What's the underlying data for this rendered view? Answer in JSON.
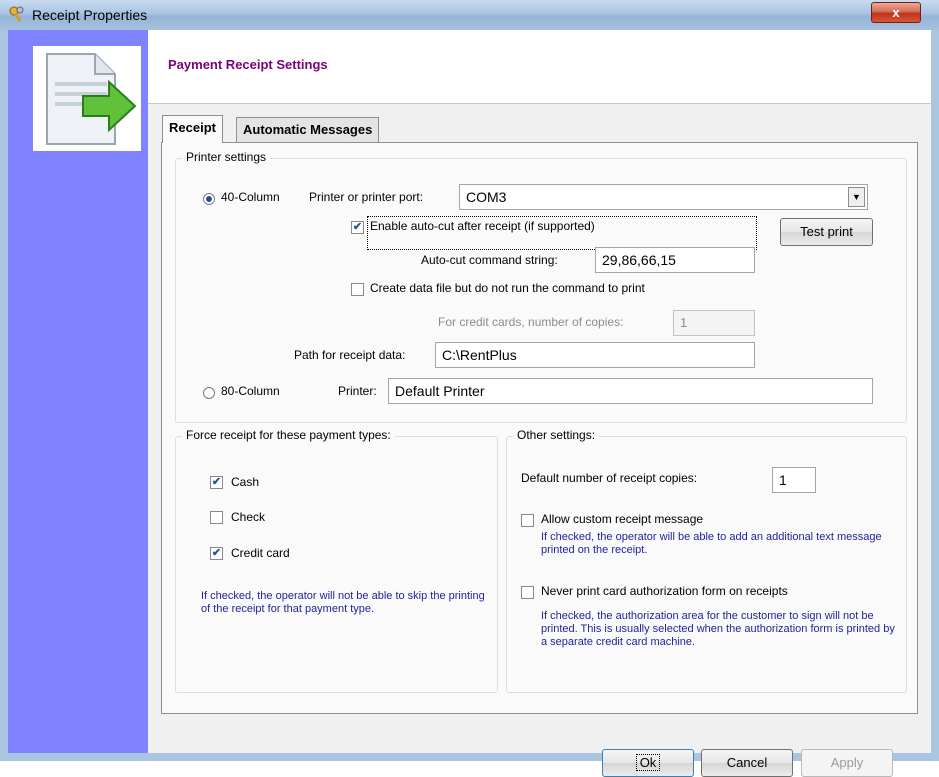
{
  "window": {
    "title": "Receipt Properties",
    "close_glyph": "x"
  },
  "header": {
    "title": "Payment Receipt Settings"
  },
  "tabs": [
    {
      "label": "Receipt",
      "active": true
    },
    {
      "label": "Automatic Messages",
      "active": false
    }
  ],
  "printer": {
    "legend": "Printer settings",
    "col40_label": "40-Column",
    "col40_selected": true,
    "port_label": "Printer or printer port:",
    "port_value": "COM3",
    "autocut_label": "Enable auto-cut after receipt (if supported)",
    "autocut_checked": true,
    "test_print_label": "Test print",
    "autocut_cmd_label": "Auto-cut command string:",
    "autocut_cmd_value": "29,86,66,15",
    "datafile_label": "Create data file but do not run the command to print",
    "datafile_checked": false,
    "cc_copies_label": "For credit cards, number of copies:",
    "cc_copies_value": "1",
    "path_label": "Path for receipt data:",
    "path_value": "C:\\RentPlus",
    "col80_label": "80-Column",
    "col80_selected": false,
    "printer80_label": "Printer:",
    "printer80_value": "Default Printer"
  },
  "force": {
    "legend": "Force receipt for these payment types:",
    "items": [
      {
        "label": "Cash",
        "checked": true
      },
      {
        "label": "Check",
        "checked": false
      },
      {
        "label": "Credit card",
        "checked": true
      }
    ],
    "help": "If checked, the operator will not be able to skip the printing of the receipt for that payment type."
  },
  "other": {
    "legend": "Other settings:",
    "copies_label": "Default number of receipt copies:",
    "copies_value": "1",
    "custom_msg_label": "Allow custom receipt message",
    "custom_msg_checked": false,
    "custom_msg_help": "If checked, the operator will be able to add an additional text message printed on the receipt.",
    "never_print_label": "Never print card authorization form on receipts",
    "never_print_checked": false,
    "never_print_help": "If checked, the authorization area for the customer to sign will not be printed. This is usually selected when the authorization form is printed by a separate credit card machine."
  },
  "buttons": {
    "ok": "Ok",
    "cancel": "Cancel",
    "apply": "Apply"
  },
  "colors": {
    "side_panel": "#7f83ff",
    "header_title": "#7b007b",
    "help_text": "#1f1f9a"
  },
  "icons": {
    "title": "keys-icon",
    "doc": "document-arrow-icon",
    "check_glyph": "✔"
  }
}
